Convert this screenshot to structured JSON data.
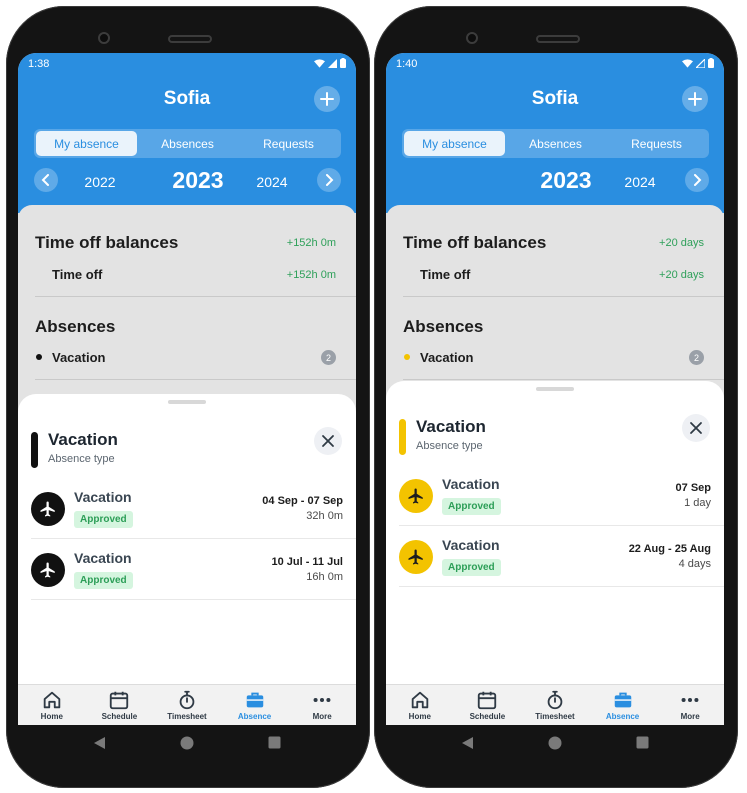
{
  "colors": {
    "header_blue": "#2a8ee0",
    "green": "#2fa05a",
    "vacation_black": "#111111",
    "vacation_yellow": "#f3c300"
  },
  "phones": [
    {
      "status_time": "1:38",
      "title": "Sofia",
      "tabs": [
        "My absence",
        "Absences",
        "Requests"
      ],
      "active_tab": "My absence",
      "years": {
        "prev": "2022",
        "current": "2023",
        "next": "2024"
      },
      "balances": {
        "title": "Time off balances",
        "total": "+152h 0m",
        "row_label": "Time off",
        "row_value": "+152h 0m"
      },
      "absences": {
        "title": "Absences",
        "item_label": "Vacation",
        "item_count": "2",
        "bullet_color": "#111111"
      },
      "sheet": {
        "type_title": "Vacation",
        "type_sub": "Absence type",
        "items": [
          {
            "name": "Vacation",
            "status": "Approved",
            "dates": "04 Sep - 07 Sep",
            "duration": "32h 0m"
          },
          {
            "name": "Vacation",
            "status": "Approved",
            "dates": "10 Jul - 11 Jul",
            "duration": "16h 0m"
          }
        ]
      }
    },
    {
      "status_time": "1:40",
      "title": "Sofia",
      "tabs": [
        "My absence",
        "Absences",
        "Requests"
      ],
      "active_tab": "My absence",
      "years": {
        "prev": "",
        "current": "2023",
        "next": "2024"
      },
      "balances": {
        "title": "Time off balances",
        "total": "+20 days",
        "row_label": "Time off",
        "row_value": "+20 days"
      },
      "absences": {
        "title": "Absences",
        "item_label": "Vacation",
        "item_count": "2",
        "bullet_color": "#f3c300"
      },
      "sheet": {
        "type_title": "Vacation",
        "type_sub": "Absence type",
        "items": [
          {
            "name": "Vacation",
            "status": "Approved",
            "dates": "07 Sep",
            "duration": "1 day"
          },
          {
            "name": "Vacation",
            "status": "Approved",
            "dates": "22 Aug - 25 Aug",
            "duration": "4 days"
          }
        ]
      }
    }
  ],
  "nav": [
    "Home",
    "Schedule",
    "Timesheet",
    "Absence",
    "More"
  ],
  "nav_active": "Absence",
  "nav_icons": [
    "home-icon",
    "calendar-icon",
    "stopwatch-icon",
    "briefcase-icon",
    "more-dots-icon"
  ]
}
